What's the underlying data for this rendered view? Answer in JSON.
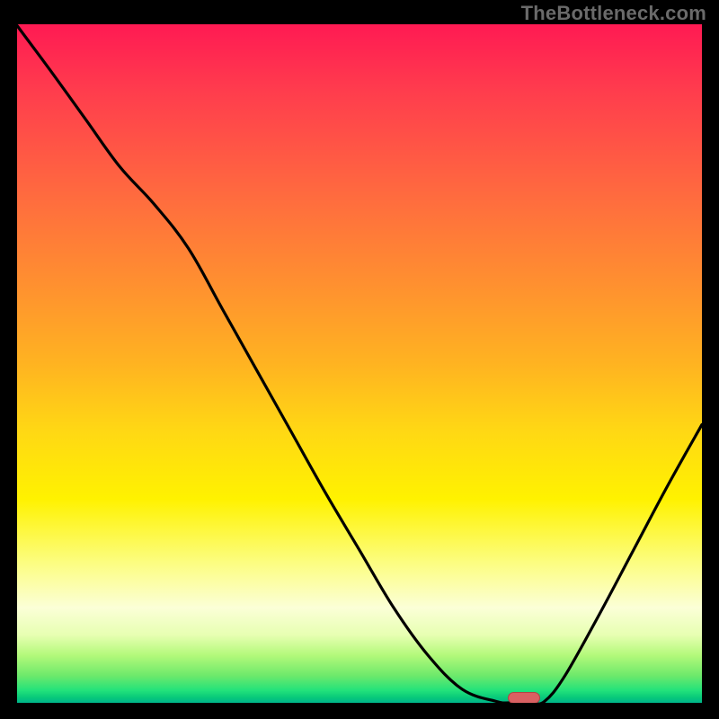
{
  "watermark": "TheBottleneck.com",
  "chart_data": {
    "type": "line",
    "title": "",
    "xlabel": "",
    "ylabel": "",
    "xlim": [
      0,
      100
    ],
    "ylim": [
      0,
      100
    ],
    "grid": false,
    "series": [
      {
        "name": "curve",
        "x": [
          0,
          5,
          10,
          15,
          20,
          25,
          30,
          35,
          40,
          45,
          50,
          55,
          60,
          65,
          70,
          72,
          75,
          77,
          80,
          85,
          90,
          95,
          100
        ],
        "y": [
          99.8,
          93,
          86,
          79,
          73.5,
          67,
          58,
          49,
          40,
          31,
          22.5,
          14,
          7,
          2,
          0.2,
          0,
          0,
          0.2,
          4,
          13,
          22.5,
          32,
          41
        ]
      }
    ],
    "marker": {
      "x": 74,
      "y": 0.5,
      "color_fill": "#d96062",
      "color_stroke": "#b44344"
    },
    "gradient_stops": [
      {
        "pos": 0,
        "color": "#ff1a53"
      },
      {
        "pos": 25,
        "color": "#ff6a3f"
      },
      {
        "pos": 50,
        "color": "#ffb321"
      },
      {
        "pos": 70,
        "color": "#fff200"
      },
      {
        "pos": 86,
        "color": "#fbffd7"
      },
      {
        "pos": 96,
        "color": "#6de96b"
      },
      {
        "pos": 100,
        "color": "#00b58b"
      }
    ]
  }
}
